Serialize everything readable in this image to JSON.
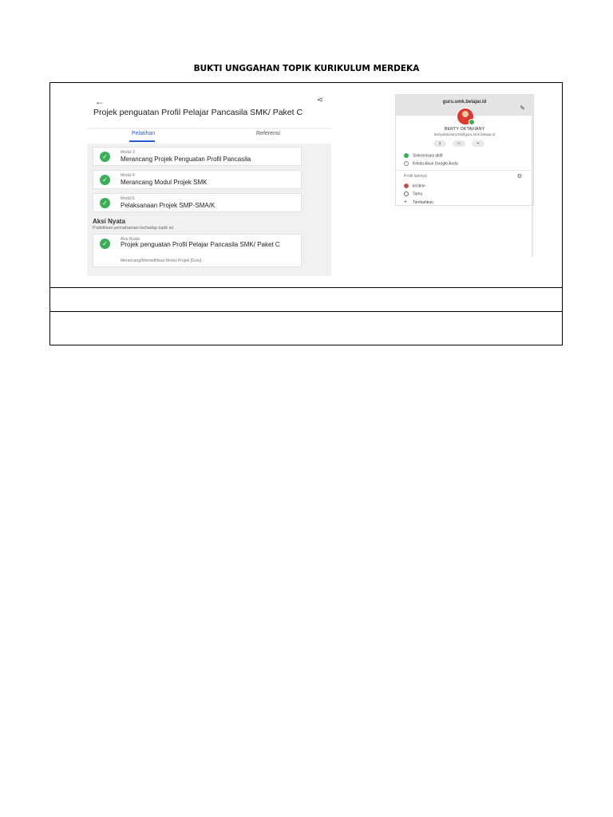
{
  "document": {
    "title": "BUKTI UNGGAHAN TOPIK KURIKULUM MERDEKA"
  },
  "course": {
    "title": "Projek penguatan Profil Pelajar Pancasila SMK/ Paket C",
    "tabs": {
      "active": "Pelatihan",
      "other": "Referensi"
    },
    "modules": [
      {
        "small": "Modul 3",
        "name": "Merancang Projek Penguatan Profil Pancasila"
      },
      {
        "small": "Modul 4",
        "name": "Merancang Modul Projek SMK"
      },
      {
        "small": "Modul 5",
        "name": "Pelaksanaan Projek SMP-SMA/K"
      }
    ],
    "aksi": {
      "heading": "Aksi Nyata",
      "subheading": "Praktikkan pemahaman terhadap topik ini",
      "card_small": "Aksi Nyata",
      "card_name": "Projek penguatan Profil Pelajar Pancasila SMK/ Paket C",
      "card_sub": "Merancang/Memodifikasi Modul Projek [Guru]"
    },
    "icons": {
      "back": "arrow-left-icon",
      "share": "share-icon",
      "check": "check-circle-icon"
    }
  },
  "account": {
    "domain": "guru.smk.belajar.id",
    "name": "BERTY OKTAVIANY",
    "email": "bertyoktaviany19@guru.smk.belajar.id",
    "sync": "Sinkronisasi aktif",
    "manage": "Kelola Akun Google Anda",
    "other_profiles": "Profil lainnya",
    "profiles": [
      "kristine",
      "Tamu",
      "Tambahkan"
    ],
    "colors": {
      "sync": "#3cae5a",
      "avatar": "#d83b2f"
    }
  }
}
